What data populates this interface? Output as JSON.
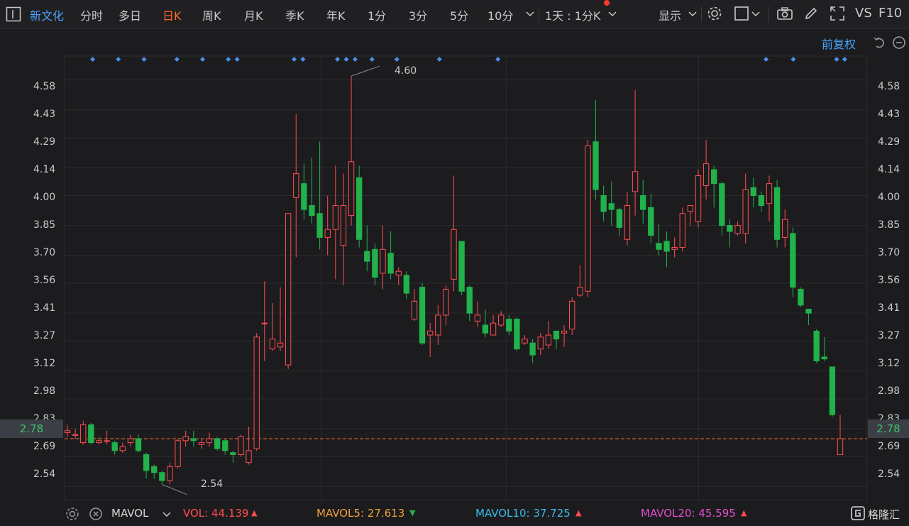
{
  "toolbar": {
    "stock_name": "新文化",
    "tabs": [
      "分时",
      "多日",
      "日K",
      "周K",
      "月K",
      "季K",
      "年K",
      "1分",
      "3分",
      "5分",
      "10分"
    ],
    "active_tab": "日K",
    "period_select": "1天 : 1分K",
    "display_label": "显示",
    "vs_label": "VS",
    "f10_label": "F10"
  },
  "chart": {
    "adjust_label": "前复权",
    "y_ticks": [
      "4.58",
      "4.43",
      "4.29",
      "4.14",
      "4.00",
      "3.85",
      "3.70",
      "3.56",
      "3.41",
      "3.27",
      "3.12",
      "2.98",
      "2.83",
      "2.69",
      "2.54"
    ],
    "current_price": "2.78",
    "high_annotation": "4.60",
    "low_annotation": "2.54"
  },
  "chart_data": {
    "type": "candlestick",
    "y_range": [
      2.47,
      4.7
    ],
    "current_price": 2.78,
    "candles": [
      [
        2.81,
        2.82,
        2.85,
        2.79
      ],
      [
        2.8,
        2.8,
        2.83,
        2.78
      ],
      [
        2.76,
        2.85,
        2.87,
        2.75
      ],
      [
        2.85,
        2.76,
        2.86,
        2.75
      ],
      [
        2.76,
        2.77,
        2.79,
        2.75
      ],
      [
        2.77,
        2.77,
        2.82,
        2.75
      ],
      [
        2.76,
        2.72,
        2.77,
        2.7
      ],
      [
        2.72,
        2.74,
        2.76,
        2.71
      ],
      [
        2.76,
        2.78,
        2.8,
        2.74
      ],
      [
        2.78,
        2.72,
        2.8,
        2.71
      ],
      [
        2.7,
        2.62,
        2.71,
        2.58
      ],
      [
        2.64,
        2.61,
        2.65,
        2.58
      ],
      [
        2.61,
        2.57,
        2.62,
        2.55
      ],
      [
        2.57,
        2.64,
        2.66,
        2.55
      ],
      [
        2.64,
        2.77,
        2.78,
        2.63
      ],
      [
        2.77,
        2.79,
        2.82,
        2.74
      ],
      [
        2.78,
        2.77,
        2.82,
        2.74
      ],
      [
        2.75,
        2.76,
        2.78,
        2.73
      ],
      [
        2.76,
        2.78,
        2.81,
        2.74
      ],
      [
        2.78,
        2.73,
        2.79,
        2.72
      ],
      [
        2.77,
        2.72,
        2.78,
        2.7
      ],
      [
        2.71,
        2.7,
        2.72,
        2.66
      ],
      [
        2.7,
        2.79,
        2.8,
        2.69
      ],
      [
        2.66,
        2.72,
        2.84,
        2.65
      ],
      [
        2.73,
        3.29,
        3.31,
        2.72
      ],
      [
        3.36,
        3.36,
        3.57,
        3.17
      ],
      [
        3.23,
        3.28,
        3.46,
        3.22
      ],
      [
        3.24,
        3.26,
        3.54,
        3.22
      ],
      [
        3.15,
        3.91,
        3.91,
        3.13
      ],
      [
        3.99,
        4.11,
        4.41,
        3.69
      ],
      [
        4.06,
        3.93,
        4.16,
        3.88
      ],
      [
        3.95,
        3.9,
        4.19,
        3.86
      ],
      [
        3.91,
        3.79,
        4.27,
        3.73
      ],
      [
        3.79,
        3.83,
        4.0,
        3.7
      ],
      [
        3.83,
        3.95,
        4.15,
        3.58
      ],
      [
        3.75,
        3.95,
        4.11,
        3.55
      ],
      [
        3.9,
        4.17,
        4.6,
        3.85
      ],
      [
        4.09,
        3.78,
        4.15,
        3.74
      ],
      [
        3.72,
        3.67,
        3.85,
        3.62
      ],
      [
        3.73,
        3.59,
        3.76,
        3.55
      ],
      [
        3.61,
        3.73,
        3.85,
        3.53
      ],
      [
        3.71,
        3.61,
        3.82,
        3.58
      ],
      [
        3.6,
        3.62,
        3.64,
        3.55
      ],
      [
        3.6,
        3.51,
        3.62,
        3.48
      ],
      [
        3.38,
        3.47,
        3.53,
        3.37
      ],
      [
        3.54,
        3.26,
        3.56,
        3.25
      ],
      [
        3.3,
        3.32,
        3.36,
        3.19
      ],
      [
        3.3,
        3.4,
        3.45,
        3.25
      ],
      [
        3.4,
        3.53,
        3.55,
        3.35
      ],
      [
        3.58,
        3.83,
        4.1,
        3.52
      ],
      [
        3.77,
        3.52,
        3.77,
        3.5
      ],
      [
        3.54,
        3.41,
        3.55,
        3.37
      ],
      [
        3.37,
        3.4,
        3.47,
        3.34
      ],
      [
        3.35,
        3.31,
        3.43,
        3.29
      ],
      [
        3.3,
        3.36,
        3.4,
        3.35
      ],
      [
        3.35,
        3.4,
        3.42,
        3.34
      ],
      [
        3.38,
        3.32,
        3.4,
        3.3
      ],
      [
        3.38,
        3.23,
        3.39,
        3.22
      ],
      [
        3.26,
        3.28,
        3.3,
        3.25
      ],
      [
        3.26,
        3.2,
        3.28,
        3.16
      ],
      [
        3.23,
        3.29,
        3.31,
        3.2
      ],
      [
        3.25,
        3.3,
        3.37,
        3.23
      ],
      [
        3.32,
        3.28,
        3.32,
        3.23
      ],
      [
        3.31,
        3.32,
        3.35,
        3.24
      ],
      [
        3.33,
        3.47,
        3.49,
        3.3
      ],
      [
        3.5,
        3.54,
        3.65,
        3.49
      ],
      [
        3.52,
        4.25,
        4.28,
        3.49
      ],
      [
        4.27,
        4.03,
        4.48,
        3.98
      ],
      [
        4.0,
        3.92,
        4.05,
        3.87
      ],
      [
        3.96,
        3.93,
        4.07,
        3.85
      ],
      [
        3.93,
        3.84,
        3.94,
        3.8
      ],
      [
        3.78,
        3.95,
        4.02,
        3.75
      ],
      [
        4.02,
        4.12,
        4.53,
        3.9
      ],
      [
        4.0,
        3.93,
        4.08,
        3.86
      ],
      [
        3.94,
        3.8,
        4.01,
        3.76
      ],
      [
        3.76,
        3.73,
        3.86,
        3.7
      ],
      [
        3.77,
        3.72,
        3.82,
        3.64
      ],
      [
        3.73,
        3.74,
        3.79,
        3.69
      ],
      [
        3.74,
        3.91,
        3.94,
        3.72
      ],
      [
        3.92,
        3.95,
        3.95,
        3.85
      ],
      [
        3.87,
        4.1,
        4.13,
        3.84
      ],
      [
        4.05,
        4.16,
        4.28,
        3.98
      ],
      [
        4.13,
        4.06,
        4.15,
        3.94
      ],
      [
        4.06,
        3.85,
        4.07,
        3.8
      ],
      [
        3.85,
        3.82,
        3.88,
        3.74
      ],
      [
        3.81,
        3.85,
        3.87,
        3.8
      ],
      [
        3.81,
        4.03,
        4.11,
        3.76
      ],
      [
        4.04,
        4.0,
        4.09,
        3.94
      ],
      [
        4.0,
        3.95,
        4.02,
        3.92
      ],
      [
        3.96,
        4.06,
        4.1,
        3.87
      ],
      [
        4.04,
        3.78,
        4.08,
        3.74
      ],
      [
        3.79,
        3.88,
        3.93,
        3.74
      ],
      [
        3.81,
        3.54,
        3.84,
        3.49
      ],
      [
        3.53,
        3.45,
        3.54,
        3.44
      ],
      [
        3.43,
        3.41,
        3.43,
        3.35
      ],
      [
        3.32,
        3.17,
        3.33,
        3.16
      ],
      [
        3.19,
        3.18,
        3.29,
        3.17
      ],
      [
        3.14,
        2.9,
        3.14,
        2.89
      ],
      [
        2.7,
        2.78,
        2.9,
        2.7
      ]
    ]
  },
  "bottom": {
    "indicator": "MAVOL",
    "vol_label": "VOL: 44.139",
    "vol_dir": "▲",
    "mavol5_label": "MAVOL5: 27.613",
    "mavol5_dir": "▼",
    "mavol10_label": "MAVOL10: 37.725",
    "mavol10_dir": "▲",
    "mavol20_label": "MAVOL20: 45.595",
    "mavol20_dir": "▲",
    "brand": "格隆汇"
  },
  "colors": {
    "up": "#ff4d4f",
    "down": "#21b24b",
    "grid": "#2c2c30",
    "marker": "#4a90e2",
    "price_line": "#ff6a2a"
  }
}
